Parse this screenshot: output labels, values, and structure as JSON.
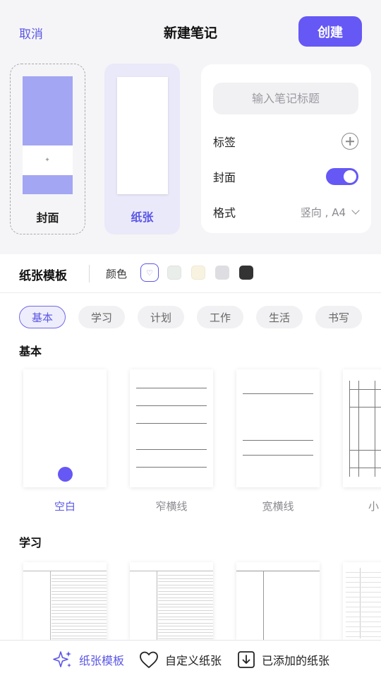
{
  "header": {
    "cancel_label": "取消",
    "title": "新建笔记",
    "create_label": "创建"
  },
  "cover": {
    "label": "封面",
    "color": "#a3a6f2"
  },
  "paper": {
    "label": "纸张"
  },
  "form": {
    "title_placeholder": "输入笔记标题",
    "title_value": "",
    "tags_label": "标签",
    "cover_label": "封面",
    "cover_enabled": true,
    "format_label": "格式",
    "format_value": "竖向 , A4"
  },
  "templates": {
    "title": "纸张模板",
    "color_label": "颜色",
    "colors": [
      {
        "name": "white",
        "hex": "#ffffff",
        "selected": true
      },
      {
        "name": "mint",
        "hex": "#eaeeea"
      },
      {
        "name": "cream",
        "hex": "#f8f3e1"
      },
      {
        "name": "gray",
        "hex": "#dedee2"
      },
      {
        "name": "black",
        "hex": "#333333"
      }
    ],
    "categories": [
      "基本",
      "学习",
      "计划",
      "工作",
      "生活",
      "书写"
    ],
    "active_category": 0
  },
  "sections": [
    {
      "title": "基本",
      "papers": [
        "空白",
        "窄横线",
        "宽横线",
        "小"
      ]
    },
    {
      "title": "学习"
    }
  ],
  "bottom_tabs": [
    {
      "label": "纸张模板",
      "icon": "sparkle-icon",
      "active": true
    },
    {
      "label": "自定义纸张",
      "icon": "heart-icon",
      "active": false
    },
    {
      "label": "已添加的纸张",
      "icon": "download-box-icon",
      "active": false
    }
  ],
  "accent": "#6558f5"
}
